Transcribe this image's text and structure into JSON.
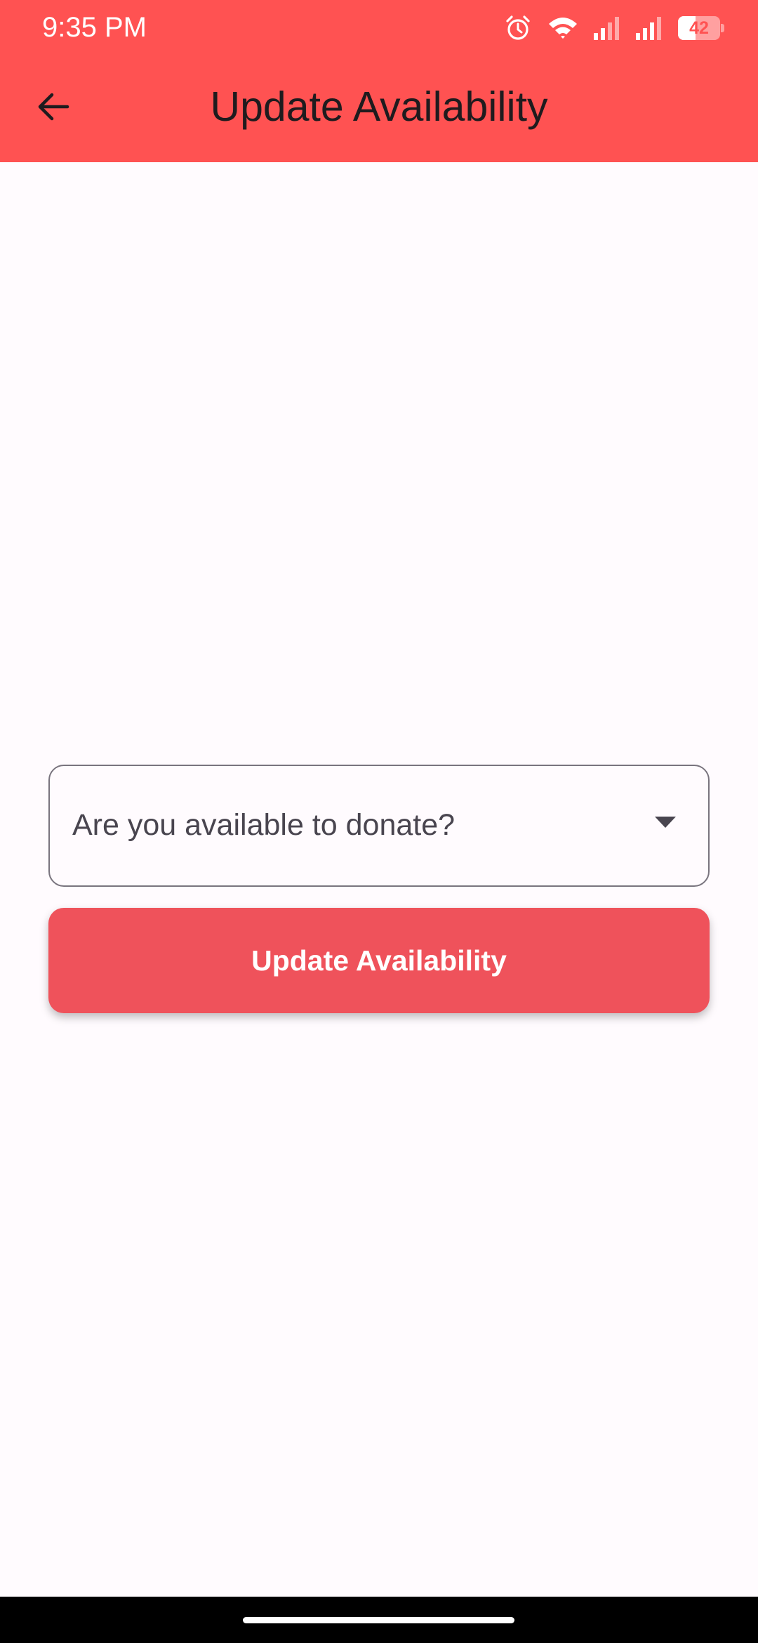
{
  "status_bar": {
    "time": "9:35 PM",
    "battery_level": "42",
    "battery_fraction": 0.42,
    "icons": [
      "alarm-icon",
      "wifi-icon",
      "signal-icon",
      "signal-icon",
      "battery-icon"
    ]
  },
  "app_bar": {
    "back_icon": "arrow-back-icon",
    "title": "Update Availability"
  },
  "form": {
    "dropdown_placeholder": "Are you available to donate?",
    "dropdown_icon": "caret-down-icon",
    "submit_label": "Update Availability"
  },
  "colors": {
    "app_bar": "#ff5252",
    "button": "#ef525b",
    "background": "#fffbfe",
    "outline": "#79747e"
  }
}
